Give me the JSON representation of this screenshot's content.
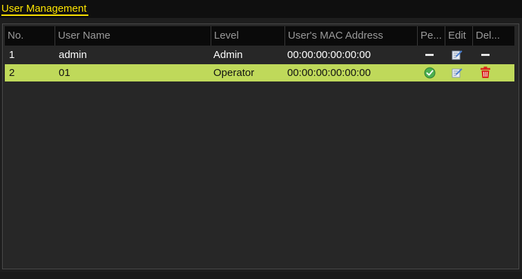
{
  "header": {
    "title": "User Management"
  },
  "table": {
    "columns": [
      "No.",
      "User Name",
      "Level",
      "User's MAC Address",
      "Pe...",
      "Edit",
      "Del..."
    ],
    "rows": [
      {
        "no": "1",
        "user_name": "admin",
        "level": "Admin",
        "mac": "00:00:00:00:00:00",
        "permission_icon": "dash-icon",
        "edit_icon": "edit-icon",
        "delete_icon": "dash-icon",
        "selected": false
      },
      {
        "no": "2",
        "user_name": "01",
        "level": "Operator",
        "mac": "00:00:00:00:00:00",
        "permission_icon": "check-icon",
        "edit_icon": "edit-icon",
        "delete_icon": "trash-icon",
        "selected": true
      }
    ]
  },
  "colors": {
    "accent": "#ffe600",
    "selected_row": "#bfd95a",
    "header_bg": "#0a0a0a",
    "panel_bg": "#272727",
    "check_green": "#4caf50",
    "trash_red": "#d9261c"
  }
}
